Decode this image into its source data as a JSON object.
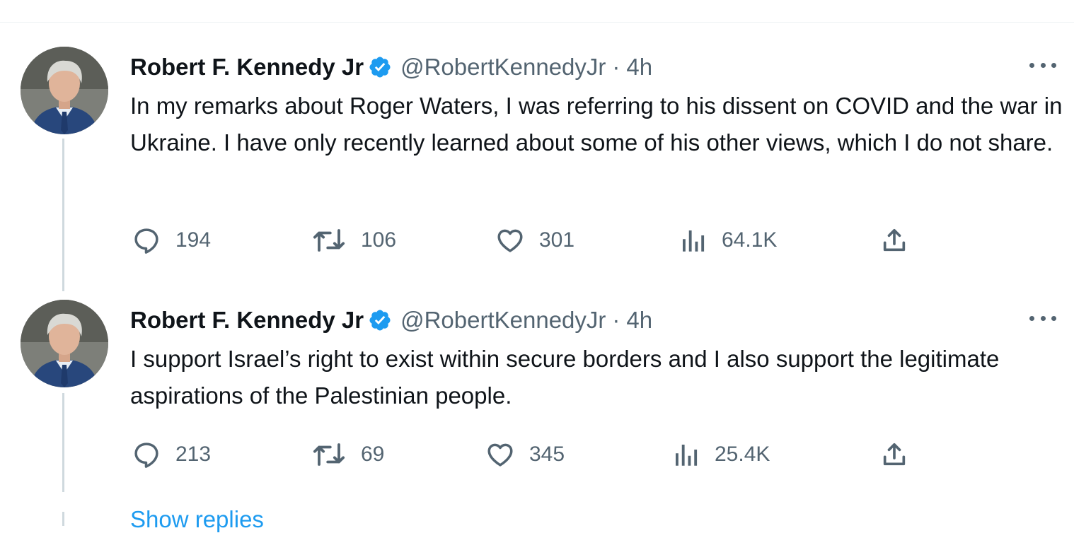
{
  "colors": {
    "text": "#0f1419",
    "secondary": "#536471",
    "link": "#1d9bf0",
    "verified": "#1d9bf0",
    "thread_line": "#cfd9de"
  },
  "tweets": [
    {
      "author": "Robert F. Kennedy Jr",
      "verified_icon": "verified-badge-icon",
      "handle": "@RobertKennedyJr",
      "separator": "·",
      "time": "4h",
      "text": "In my remarks about Roger Waters, I was referring to his dissent on COVID and the war in Ukraine. I have only recently learned about some of his other views, which I do not share.",
      "replies": "194",
      "retweets": "106",
      "likes": "301",
      "views": "64.1K"
    },
    {
      "author": "Robert F. Kennedy Jr",
      "verified_icon": "verified-badge-icon",
      "handle": "@RobertKennedyJr",
      "separator": "·",
      "time": "4h",
      "text": "I support Israel’s right to exist within secure borders and I also support the legitimate aspirations of the Palestinian people.",
      "replies": "213",
      "retweets": "69",
      "likes": "345",
      "views": "25.4K"
    }
  ],
  "show_replies_label": "Show replies"
}
